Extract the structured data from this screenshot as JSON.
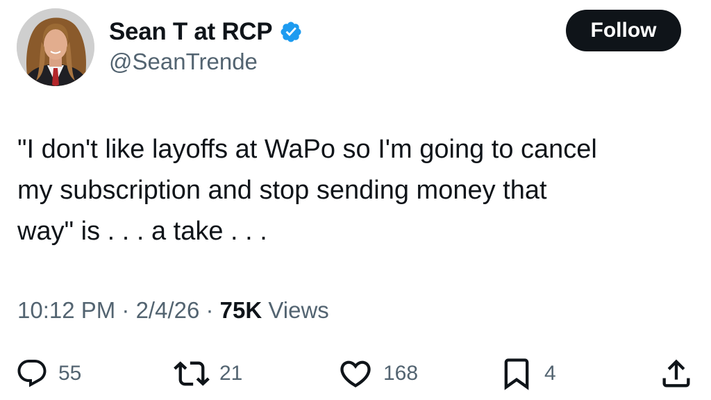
{
  "author": {
    "name": "Sean T at RCP",
    "handle": "@SeanTrende",
    "verified": true,
    "avatar_icon": "avatar-photo"
  },
  "follow_button": {
    "label": "Follow"
  },
  "tweet": {
    "text": "\"I don't like layoffs at WaPo so I'm going to cancel\nmy subscription and stop sending money that\nway\" is . . . a take . . ."
  },
  "meta": {
    "time": "10:12 PM",
    "separator": " · ",
    "date": "2/4/26",
    "views_count": "75K",
    "views_label": "Views"
  },
  "actions": {
    "reply": {
      "icon": "reply-icon",
      "count": "55"
    },
    "retweet": {
      "icon": "retweet-icon",
      "count": "21"
    },
    "like": {
      "icon": "heart-icon",
      "count": "168"
    },
    "bookmark": {
      "icon": "bookmark-icon",
      "count": "4"
    },
    "share": {
      "icon": "share-icon"
    }
  },
  "colors": {
    "text_primary": "#0f1419",
    "text_secondary": "#536471",
    "verified_blue": "#1d9bf0",
    "follow_bg": "#0f1419"
  }
}
